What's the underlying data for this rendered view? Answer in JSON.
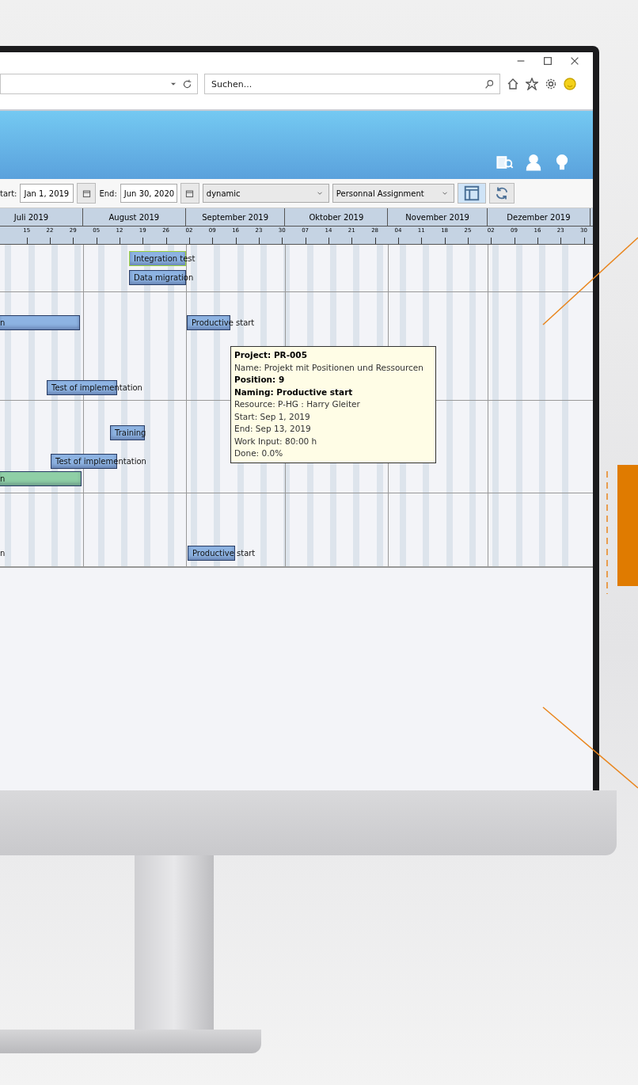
{
  "browser": {
    "search": {
      "placeholder": "Suchen..."
    }
  },
  "toolbar": {
    "start_label": "tart:",
    "start_value": "Jan 1, 2019",
    "end_label": "End:",
    "end_value": "Jun 30, 2020",
    "mode": "dynamic",
    "view": "Personnal Assignment",
    "calendar_selected": true
  },
  "months": [
    {
      "label": "Juli 2019",
      "days": [
        "15",
        "22",
        "29"
      ]
    },
    {
      "label": "August 2019",
      "days": [
        "05",
        "12",
        "19",
        "26"
      ]
    },
    {
      "label": "September 2019",
      "days": [
        "02",
        "09",
        "16",
        "23",
        "30"
      ]
    },
    {
      "label": "Oktober 2019",
      "days": [
        "07",
        "14",
        "21",
        "28"
      ]
    },
    {
      "label": "November 2019",
      "days": [
        "04",
        "11",
        "18",
        "25"
      ]
    },
    {
      "label": "Dezember 2019",
      "days": [
        "02",
        "09",
        "16",
        "23",
        "30"
      ]
    }
  ],
  "bars": [
    {
      "kind": "bar",
      "label": "Integration test",
      "color": "#8db3e2",
      "selected": true
    },
    {
      "kind": "bar",
      "label": "Data migration",
      "color": "#8db3e2",
      "selected": false
    },
    {
      "kind": "bar",
      "label": "n",
      "color": "#8db3e2",
      "selected": false
    },
    {
      "kind": "bar",
      "label": "Productive start",
      "color": "#8db3e2",
      "selected": false
    },
    {
      "kind": "bar",
      "label": "Test of implementation",
      "color": "#8db3e2",
      "selected": false
    },
    {
      "kind": "bar",
      "label": "Training",
      "color": "#8db3e2",
      "selected": false
    },
    {
      "kind": "bar",
      "label": "Test of implementation",
      "color": "#8db3e2",
      "selected": false
    },
    {
      "kind": "bar",
      "label": "n",
      "color": "#8fcfa6",
      "selected": false
    },
    {
      "kind": "label",
      "label": "n"
    },
    {
      "kind": "bar",
      "label": "Productive start",
      "color": "#8db3e2",
      "selected": false
    }
  ],
  "tooltip": {
    "lines": [
      {
        "text": "Project: PR-005",
        "bold": true
      },
      {
        "text": "Name: Projekt mit Positionen und Ressourcen",
        "bold": false
      },
      {
        "text": "Position: 9",
        "bold": true
      },
      {
        "text": "Naming: Productive start",
        "bold": true
      },
      {
        "text": "Resource: P-HG : Harry Gleiter",
        "bold": false
      },
      {
        "text": "Start: Sep 1, 2019",
        "bold": false
      },
      {
        "text": "End: Sep 13, 2019",
        "bold": false
      },
      {
        "text": "Work Input: 80:00 h",
        "bold": false
      },
      {
        "text": "Done: 0.0%",
        "bold": false
      }
    ]
  }
}
